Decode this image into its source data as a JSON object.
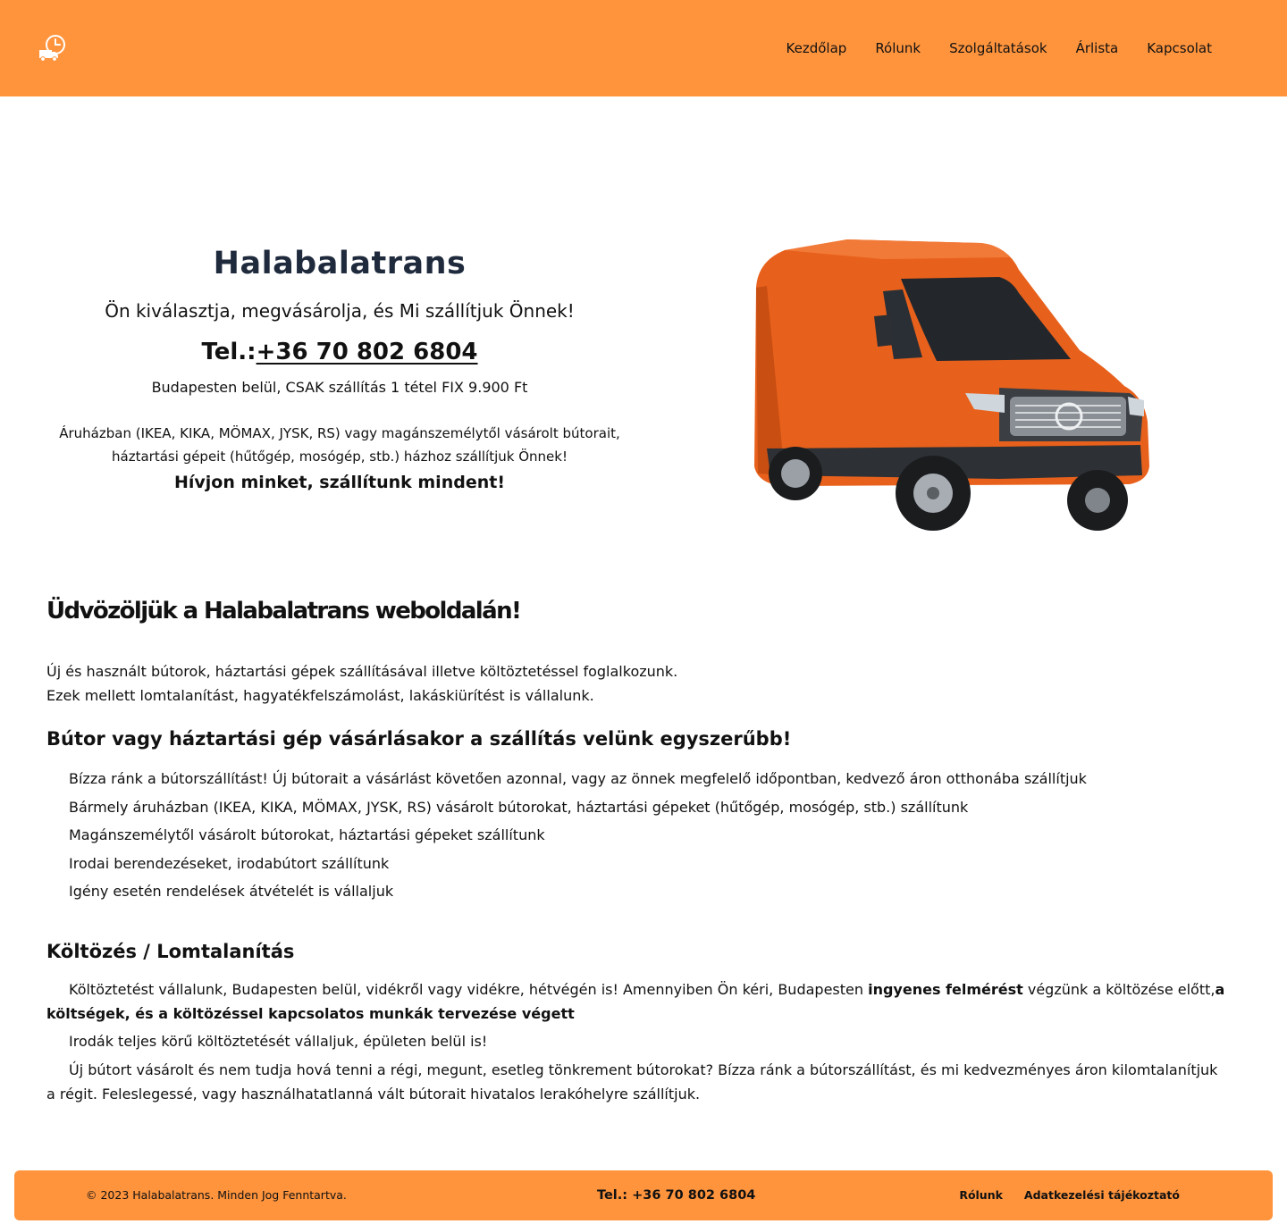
{
  "header": {
    "logo_icon": "delivery-truck-clock-icon",
    "nav": [
      "Kezdőlap",
      "Rólunk",
      "Szolgáltatások",
      "Árlista",
      "Kapcsolat"
    ]
  },
  "hero": {
    "title": "Halabalatrans",
    "subtitle": "Ön kiválasztja, megvásárolja, és Mi szállítjuk Önnek!",
    "phone_prefix": "Tel.:",
    "phone": "+36 70 802 6804",
    "price": "Budapesten belül, CSAK szállítás 1 tétel FIX 9.900 Ft",
    "desc_line1": "Áruházban (IKEA, KIKA, MÖMAX, JYSK, RS) vagy magánszemélytől vásárolt bútorait,",
    "desc_line2": "háztartási gépeit (hűtőgép, mosógép, stb.) házhoz szállítjuk Önnek!",
    "cta": "Hívjon minket, szállítunk mindent!",
    "van_color": "#e8611c"
  },
  "main": {
    "welcome": "Üdvözöljük a Halabalatrans weboldalán!",
    "intro_line1": "Új és használt bútorok, háztartási gépek szállításával illetve költöztetéssel foglalkozunk.",
    "intro_line2": "Ezek mellett lomtalanítást, hagyatékfelszámolást, lakáskiürítést is vállalunk.",
    "furniture_heading": "Bútor vagy háztartási gép vásárlásakor a szállítás velünk egyszerűbb!",
    "furniture_items": [
      "Bízza ránk a bútorszállítást! Új bútorait a vásárlást követően azonnal, vagy az önnek megfelelő időpontban, kedvező áron otthonába szállítjuk",
      "Bármely áruházban (IKEA, KIKA, MÖMAX, JYSK, RS) vásárolt bútorokat, háztartási gépeket (hűtőgép, mosógép, stb.) szállítunk",
      "Magánszemélytől vásárolt bútorokat, háztartási gépeket szállítunk",
      "Irodai berendezéseket, irodabútort szállítunk",
      "Igény esetén rendelések átvételét is vállaljuk"
    ],
    "moving_heading": "Költözés / Lomtalanítás",
    "moving_p1_a": "Költöztetést vállalunk, Budapesten belül, vidékről vagy vidékre, hétvégén is! Amennyiben Ön kéri, Budapesten ",
    "moving_p1_bold1": "ingyenes felmérést",
    "moving_p1_b": " végzünk a költözése előtt,",
    "moving_p1_bold2": "a költségek, és a költözéssel kapcsolatos munkák tervezése végett",
    "moving_p2": "Irodák teljes körű költöztetését vállaljuk, épületen belül is!",
    "moving_p3": "Új bútort vásárolt és nem tudja hová tenni a régi, megunt, esetleg tönkrement bútorokat? Bízza ránk a bútorszállítást, és mi kedvezményes áron kilomtalanítjuk a régit. Feleslegessé, vagy használhatatlanná vált bútorait hivatalos lerakóhelyre szállítjuk."
  },
  "footer": {
    "copyright": "© 2023 Halabalatrans. Minden Jog Fenntartva.",
    "phone": "Tel.: +36 70 802 6804",
    "links": [
      "Rólunk",
      "Adatkezelési tájékoztató"
    ]
  },
  "colors": {
    "accent": "#ff943d",
    "heading": "#1f2a3d",
    "text": "#111111"
  }
}
